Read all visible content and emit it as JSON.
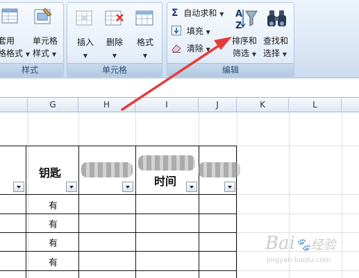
{
  "ribbon": {
    "group_styles": {
      "btn1_line1": "套用",
      "btn1_line2": "格格式",
      "btn2_line1": "单元格",
      "btn2_line2": "样式",
      "label": "样式"
    },
    "group_cells": {
      "insert": "插入",
      "delete": "删除",
      "format": "格式",
      "label": "单元格"
    },
    "group_edit": {
      "autosum": "自动求和",
      "fill": "填充",
      "clear": "清除",
      "sort_line1": "排序和",
      "sort_line2": "筛选",
      "find_line1": "查找和",
      "find_line2": "选择",
      "label": "编辑"
    }
  },
  "columns": [
    "G",
    "H",
    "I",
    "J",
    "K",
    "L"
  ],
  "table": {
    "headers": {
      "g": "钥匙",
      "i": "时间"
    },
    "g_values": [
      "有",
      "有",
      "有",
      "有"
    ]
  },
  "watermark": {
    "main": "Bai",
    "cn": "经验",
    "url": "jingyan.baidu.com"
  },
  "colors": {
    "arrow": "#e53b3b",
    "ribbon_label": "#2f4d72"
  }
}
